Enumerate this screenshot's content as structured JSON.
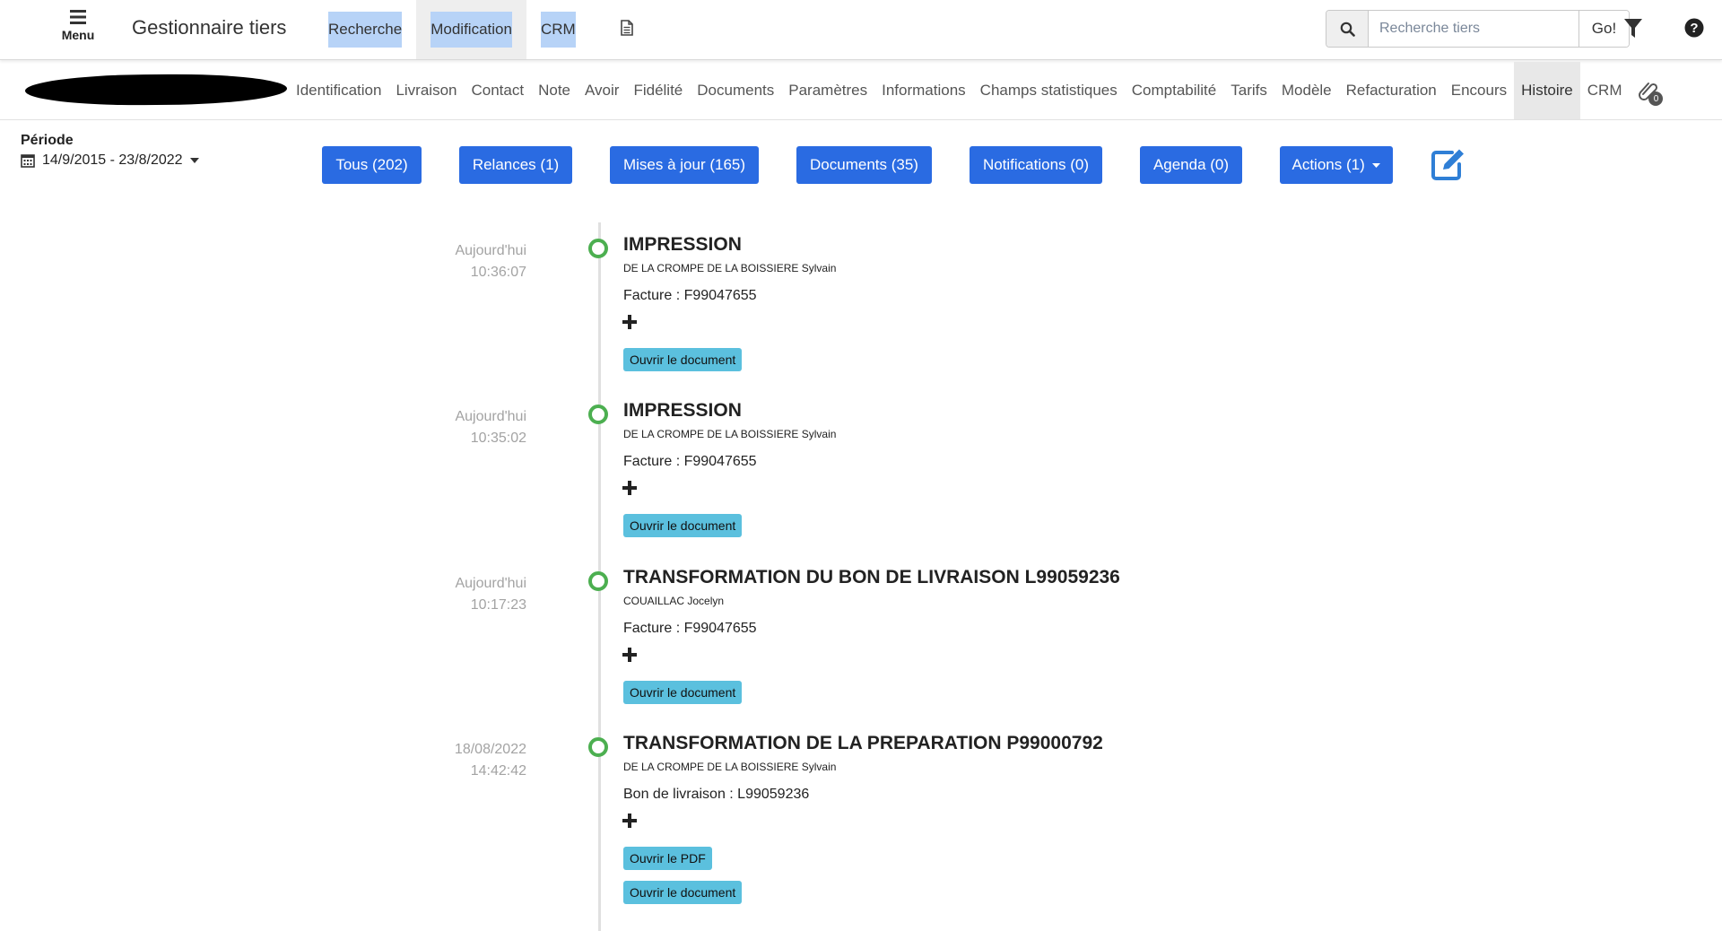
{
  "header": {
    "menu_label": "Menu",
    "app_title": "Gestionnaire tiers",
    "nav": [
      "Recherche",
      "Modification",
      "CRM"
    ],
    "search": {
      "placeholder": "Recherche tiers",
      "go_label": "Go!"
    }
  },
  "subnav": {
    "tabs": [
      "Identification",
      "Livraison",
      "Contact",
      "Note",
      "Avoir",
      "Fidélité",
      "Documents",
      "Paramètres",
      "Informations",
      "Champs statistiques",
      "Comptabilité",
      "Tarifs",
      "Modèle",
      "Refacturation",
      "Encours",
      "Histoire",
      "CRM"
    ],
    "active_tab": "Histoire",
    "attachment_count": "0"
  },
  "period": {
    "label": "Période",
    "value": "14/9/2015 - 23/8/2022"
  },
  "filters": [
    "Tous (202)",
    "Relances (1)",
    "Mises à jour (165)",
    "Documents (35)",
    "Notifications (0)",
    "Agenda (0)",
    "Actions (1)"
  ],
  "timeline": [
    {
      "day": "Aujourd'hui",
      "time": "10:36:07",
      "title": "IMPRESSION",
      "author": "DE LA CROMPE DE LA BOISSIERE Sylvain",
      "ref": "Facture : F99047655",
      "buttons": [
        "Ouvrir le document"
      ]
    },
    {
      "day": "Aujourd'hui",
      "time": "10:35:02",
      "title": "IMPRESSION",
      "author": "DE LA CROMPE DE LA BOISSIERE Sylvain",
      "ref": "Facture : F99047655",
      "buttons": [
        "Ouvrir le document"
      ]
    },
    {
      "day": "Aujourd'hui",
      "time": "10:17:23",
      "title": "TRANSFORMATION DU BON DE LIVRAISON L99059236",
      "author": "COUAILLAC Jocelyn",
      "ref": "Facture : F99047655",
      "buttons": [
        "Ouvrir le document"
      ]
    },
    {
      "day": "18/08/2022",
      "time": "14:42:42",
      "title": "TRANSFORMATION DE LA PREPARATION P99000792",
      "author": "DE LA CROMPE DE LA BOISSIERE Sylvain",
      "ref": "Bon de livraison : L99059236",
      "buttons": [
        "Ouvrir le PDF",
        "Ouvrir le document"
      ]
    }
  ],
  "colors": {
    "primary_button": "#2a6be2",
    "info_button": "#5bc0de",
    "marker": "#4caf50",
    "nav_highlight": "#b7d3f7"
  }
}
